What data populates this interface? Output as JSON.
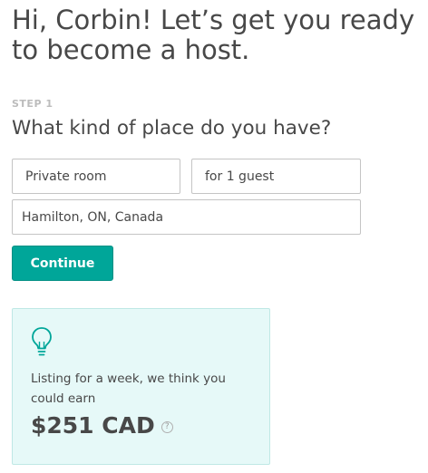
{
  "header": {
    "title": "Hi, Corbin! Let’s get you ready to become a host."
  },
  "step": {
    "label": "STEP 1",
    "question": "What kind of place do you have?"
  },
  "form": {
    "room_type": "Private room",
    "guests": "for 1 guest",
    "location": "Hamilton, ON, Canada",
    "continue_label": "Continue"
  },
  "estimate": {
    "text": "Listing for a week, we think you could earn",
    "amount": "$251 CAD",
    "help_symbol": "?",
    "icon": "lightbulb-icon",
    "accent_color": "#00a699"
  },
  "colors": {
    "primary": "#00a699",
    "text": "#484848",
    "card_background": "#e6f9f8"
  }
}
